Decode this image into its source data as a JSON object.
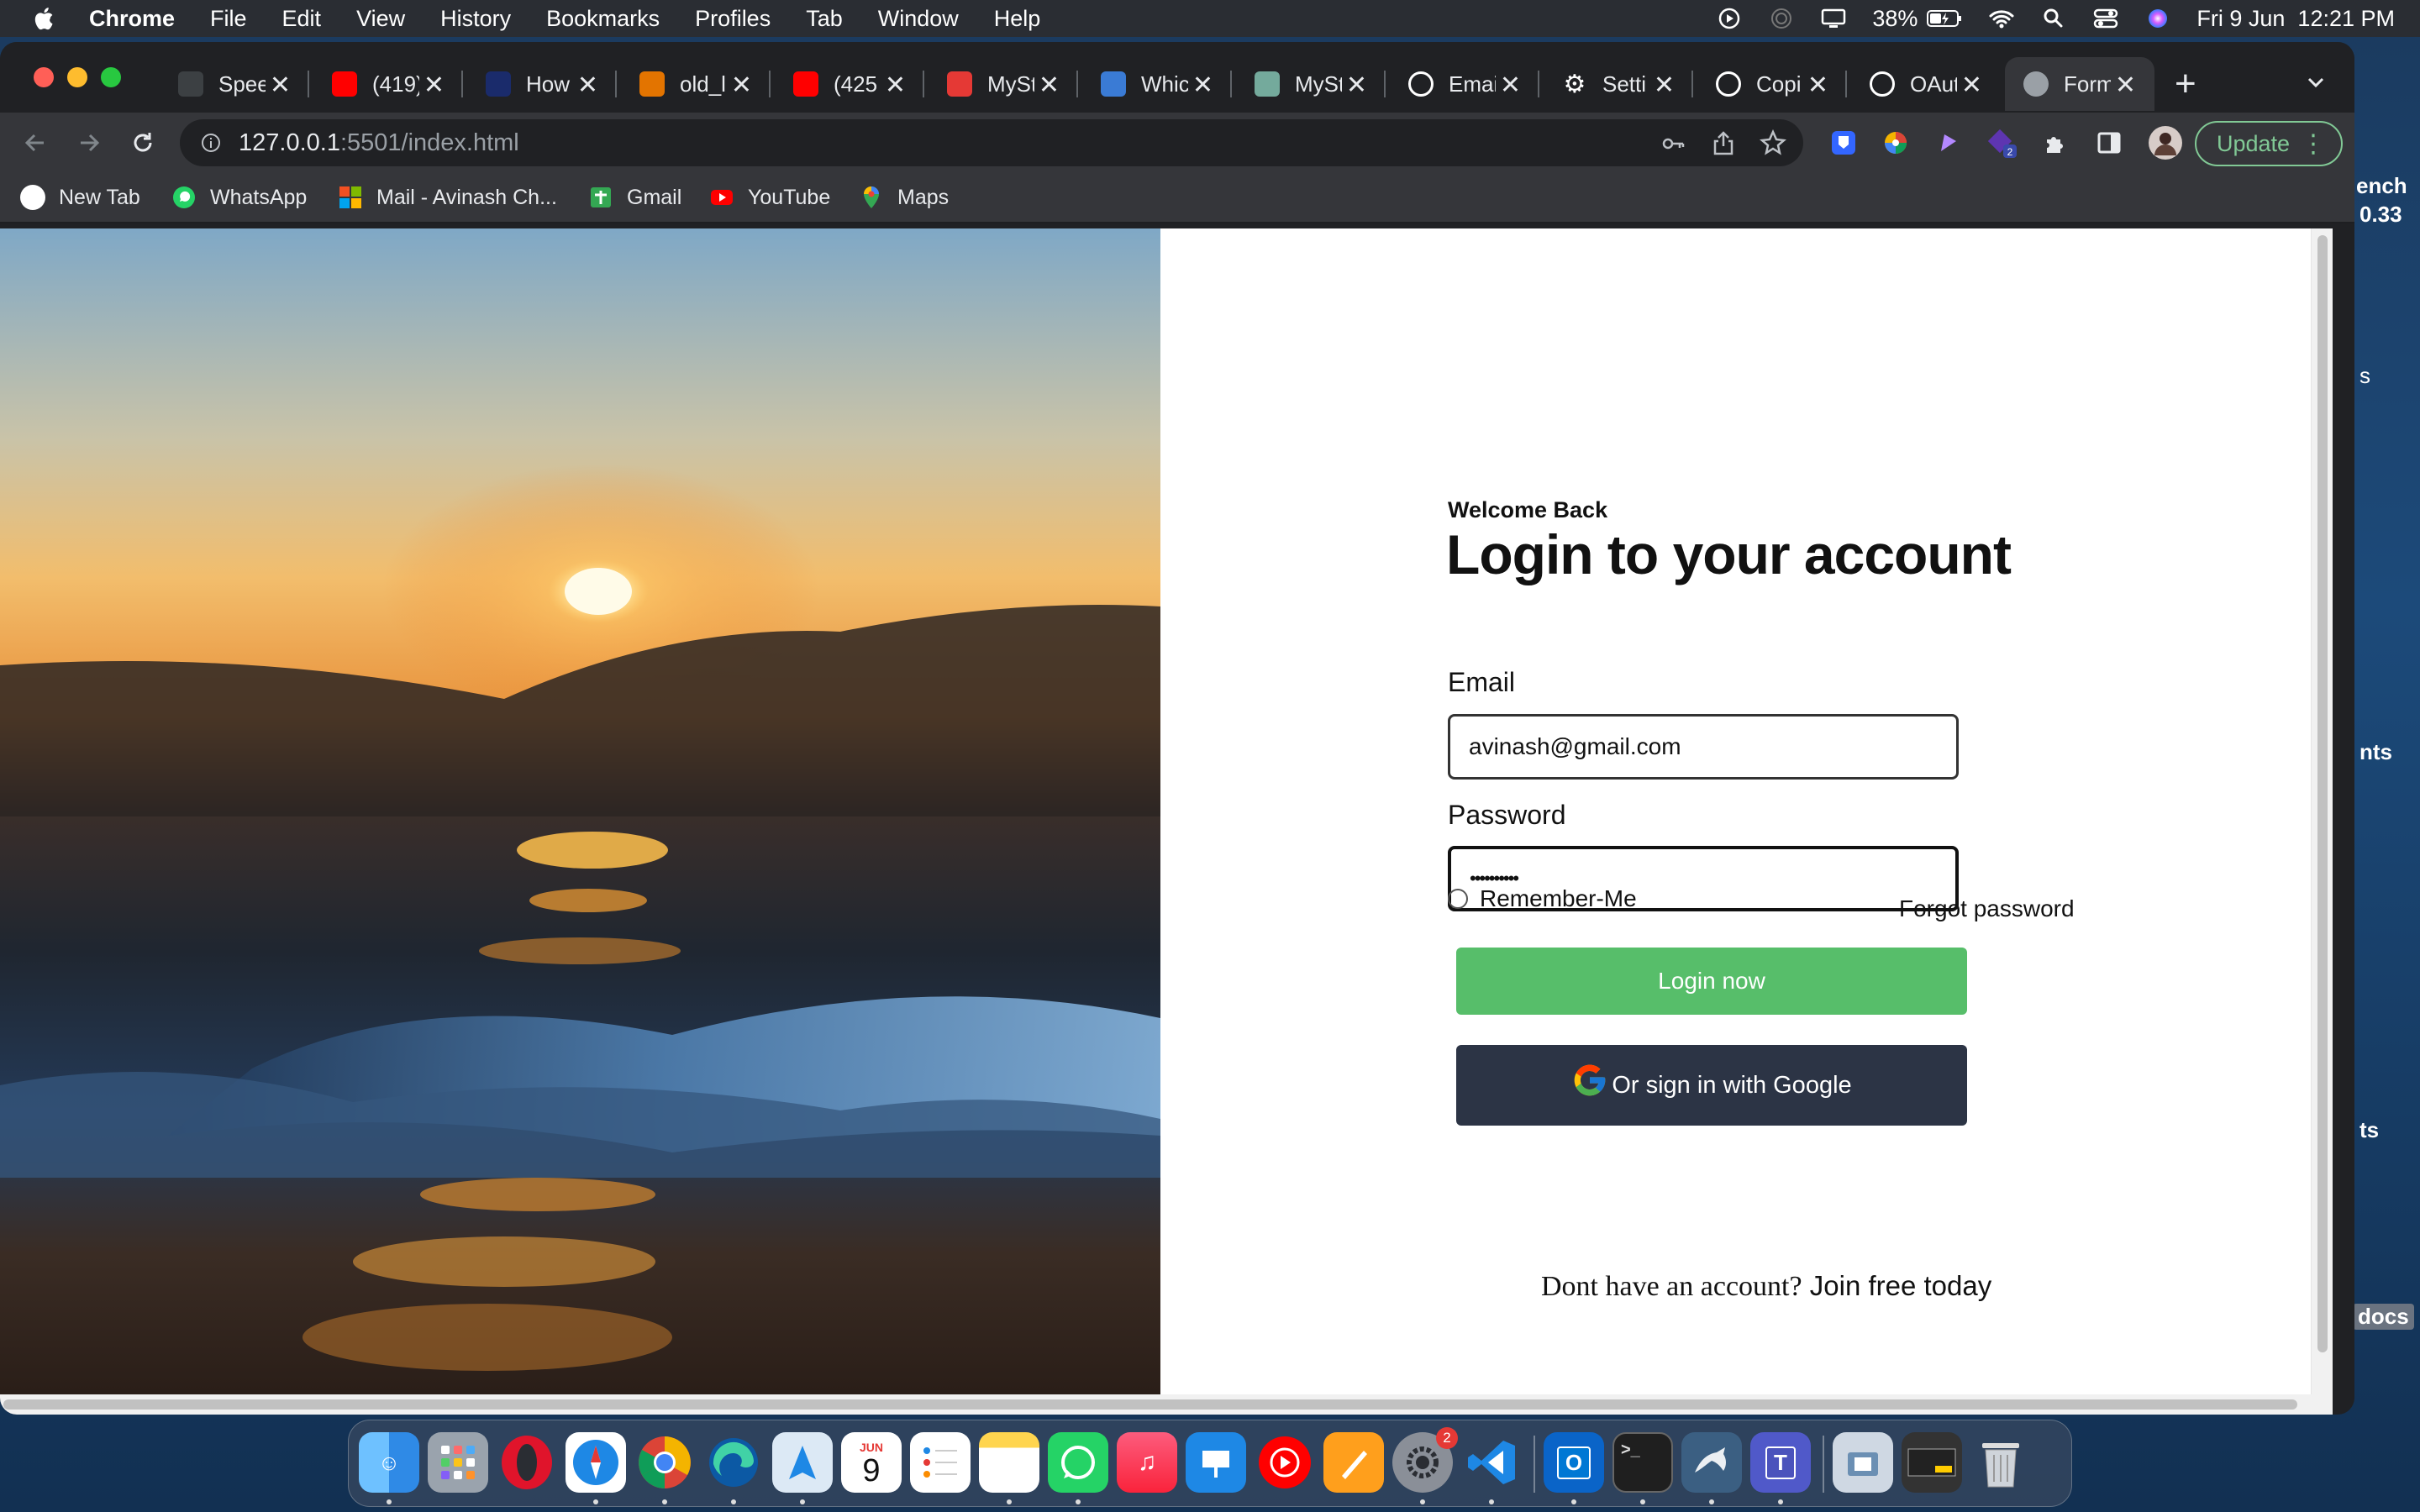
{
  "menubar": {
    "app_name": "Chrome",
    "items": [
      "File",
      "Edit",
      "View",
      "History",
      "Bookmarks",
      "Profiles",
      "Tab",
      "Window",
      "Help"
    ],
    "battery": "38%",
    "datetime": "Fri 9 Jun  12:21 PM"
  },
  "tabs": [
    {
      "title": "Spee",
      "icon": "speed-icon",
      "color": "#3c4043"
    },
    {
      "title": "(419)",
      "icon": "youtube-icon",
      "color": "#ff0000"
    },
    {
      "title": "How",
      "icon": "how-icon",
      "color": "#1a2b6b"
    },
    {
      "title": "old_l",
      "icon": "old-icon",
      "color": "#e37400"
    },
    {
      "title": "(425",
      "icon": "youtube-icon",
      "color": "#ff0000"
    },
    {
      "title": "MySt",
      "icon": "mysql-tutorial-icon",
      "color": "#e53935"
    },
    {
      "title": "Whic",
      "icon": "which-icon",
      "color": "#3a7bd5"
    },
    {
      "title": "MySt",
      "icon": "chatgpt-icon",
      "color": "#74aa9c"
    },
    {
      "title": "Emai",
      "icon": "github-icon",
      "color": "#ffffff"
    },
    {
      "title": "Setti",
      "icon": "settings-icon",
      "color": "#ffffff"
    },
    {
      "title": "Copi",
      "icon": "github-icon",
      "color": "#ffffff"
    },
    {
      "title": "OAut",
      "icon": "github-icon",
      "color": "#ffffff"
    },
    {
      "title": "Form",
      "icon": "globe-icon",
      "color": "#9aa0a6",
      "active": true
    }
  ],
  "toolbar": {
    "url_host": "127.0.0.1",
    "url_path": ":5501/index.html",
    "update_label": "Update"
  },
  "bookmarks": [
    {
      "label": "New Tab",
      "icon": "new-tab-icon"
    },
    {
      "label": "WhatsApp",
      "icon": "whatsapp-icon"
    },
    {
      "label": "Mail - Avinash Ch...",
      "icon": "microsoft-icon"
    },
    {
      "label": "Gmail",
      "icon": "gmail-icon"
    },
    {
      "label": "YouTube",
      "icon": "youtube-icon"
    },
    {
      "label": "Maps",
      "icon": "maps-icon"
    }
  ],
  "login": {
    "welcome": "Welcome Back",
    "heading": "Login to your account",
    "email_label": "Email",
    "email_value": "avinash@gmail.com",
    "password_label": "Password",
    "password_value": "••••••••••",
    "remember_label": "Remember-Me",
    "forgot_label": "Forgot password",
    "login_button": "Login now",
    "google_button": "Or sign in with Google",
    "signup_prompt": "Dont have an account?",
    "signup_link": "Join free today"
  },
  "desktop_peek": {
    "line1": "ench",
    "line2": "0.33",
    "line3": "s",
    "line4": "nts",
    "line5": "ts",
    "line6": "docs"
  },
  "dock": {
    "apps": [
      "finder",
      "launchpad",
      "opera",
      "safari",
      "chrome",
      "edge",
      "maps",
      "calendar",
      "reminders",
      "notes",
      "whatsapp",
      "music",
      "keynote",
      "youtube-music",
      "pages",
      "system-settings",
      "vscode",
      "outlook",
      "terminal",
      "mysql-workbench",
      "teams",
      "downloads",
      "screenshot",
      "trash"
    ],
    "calendar_month": "JUN",
    "calendar_day": "9",
    "settings_badge": "2"
  },
  "colors": {
    "login_button": "#57be6a",
    "google_button": "#2c3445",
    "update_accent": "#81c995"
  }
}
